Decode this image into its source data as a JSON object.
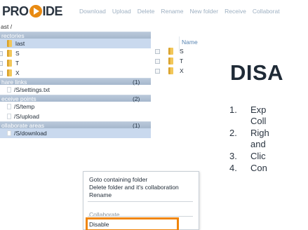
{
  "app": {
    "logo_left": "PRO",
    "logo_right": "IDE"
  },
  "toolbar": {
    "items": [
      "Download",
      "Upload",
      "Delete",
      "Rename",
      "New folder",
      "Receive",
      "Collaborat"
    ]
  },
  "breadcrumb": "ast /",
  "left": {
    "directories": {
      "header": "rectories",
      "items": [
        {
          "label": "last",
          "selected": true
        },
        {
          "label": "S"
        },
        {
          "label": "T"
        },
        {
          "label": "X"
        }
      ]
    },
    "share_links": {
      "header": "hare links",
      "count": "(1)",
      "items": [
        "/S/settings.txt"
      ]
    },
    "receive_points": {
      "header": "eceive points",
      "count": "(2)",
      "items": [
        "/S/temp",
        "/S/upload"
      ]
    },
    "collaborate": {
      "header": "ollaborate areas",
      "count": "(1)",
      "items": [
        "/S/download"
      ]
    }
  },
  "listing": {
    "column_header": "Name",
    "rows": [
      "S",
      "T",
      "X"
    ]
  },
  "instructions": {
    "heading": "DISA",
    "steps": [
      {
        "num": "1.",
        "lines": [
          "Exp",
          "Coll"
        ]
      },
      {
        "num": "2.",
        "lines": [
          "Righ",
          "and"
        ]
      },
      {
        "num": "3.",
        "lines": [
          "Clic"
        ]
      },
      {
        "num": "4.",
        "lines": [
          "Con"
        ]
      }
    ]
  },
  "context_menu": {
    "items": [
      "Goto containing folder",
      "Delete folder and it's collaboration",
      "Rename",
      "Collaborate",
      "Disable"
    ],
    "highlight_color": "#f0850a"
  },
  "colors": {
    "accent": "#e88a12",
    "section_header": "#a6b8cd",
    "selected_row": "#c9d9ee",
    "link": "#5a86b3"
  }
}
